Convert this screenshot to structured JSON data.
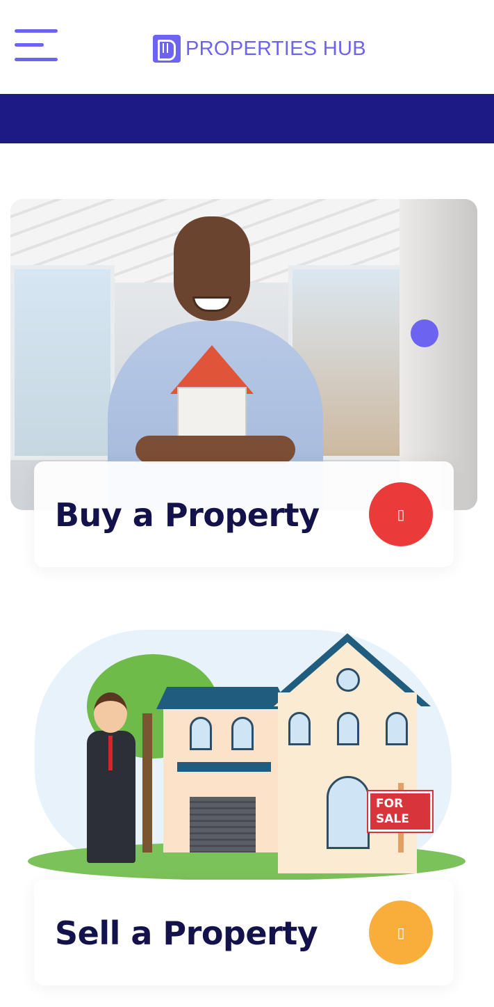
{
  "header": {
    "menu_icon": "hamburger-menu-icon",
    "brand_logo_icon": "properties-hub-logo-icon",
    "brand_name": "PROPERTIES HUB"
  },
  "colors": {
    "accent": "#6c63f0",
    "banner": "#1e1a85",
    "buy_button": "#ea3a3a",
    "sell_button": "#f9ad3b",
    "title_text": "#14124a"
  },
  "cards": [
    {
      "title": "Buy a Property",
      "image": "man-holding-house-photo",
      "button_icon": "arrow-icon",
      "button_glyph": "▯"
    },
    {
      "title": "Sell a Property",
      "image": "agent-house-for-sale-illustration",
      "button_icon": "arrow-icon",
      "button_glyph": "▯",
      "sign_text": "FOR SALE"
    }
  ]
}
